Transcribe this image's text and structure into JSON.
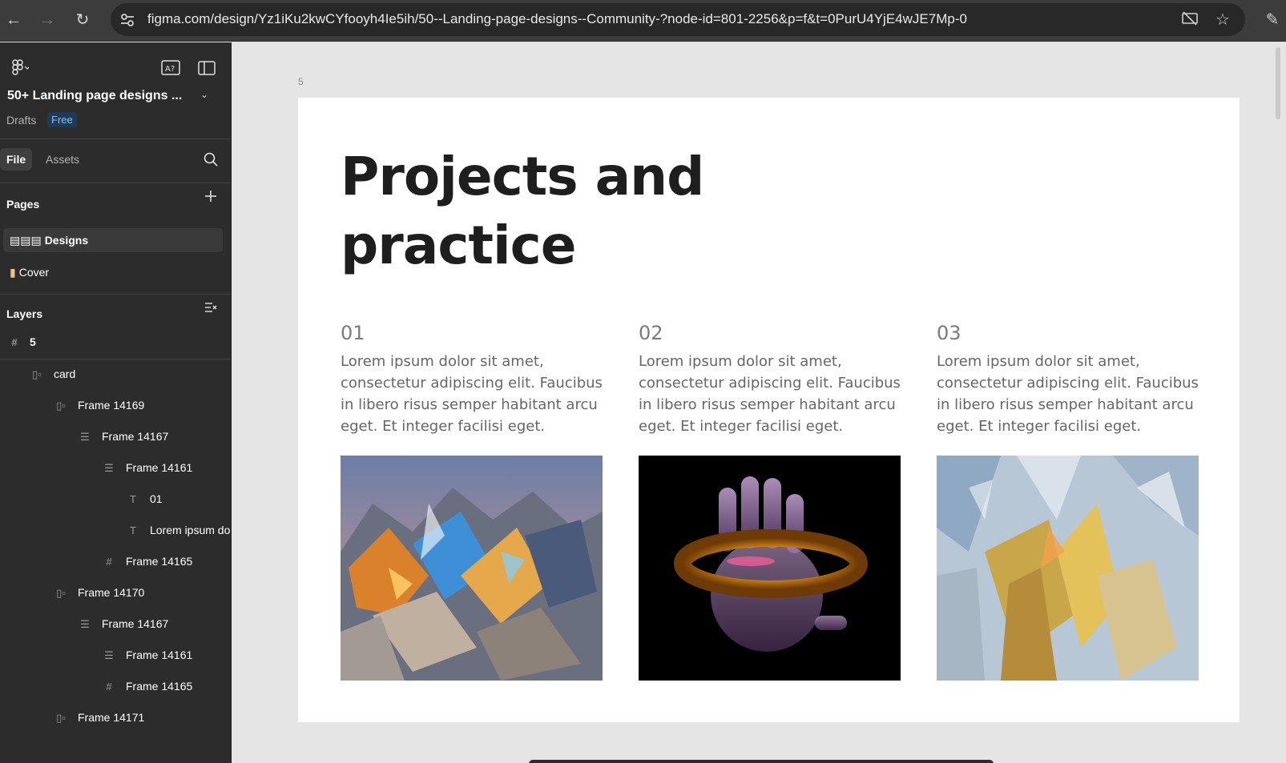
{
  "browser": {
    "url": "figma.com/design/Yz1iKu2kwCYfooyh4Ie5ih/50--Landing-page-designs--Community-?node-id=801-2256&p=f&t=0PurU4YjE4wJE7Mp-0"
  },
  "sidebar": {
    "file_title": "50+ Landing page designs ...",
    "drafts_label": "Drafts",
    "plan_badge": "Free",
    "tabs": {
      "file": "File",
      "assets": "Assets"
    },
    "pages_title": "Pages",
    "pages": [
      {
        "emoji": "▤▤▤",
        "label": "Designs"
      },
      {
        "emoji": "▮",
        "label": "Cover"
      }
    ],
    "layers_title": "Layers",
    "layers": [
      {
        "icon": "#",
        "label": "5"
      },
      {
        "icon": "▯▫",
        "label": "card"
      },
      {
        "icon": "▯▫",
        "label": "Frame 14169"
      },
      {
        "icon": "☰",
        "label": "Frame 14167"
      },
      {
        "icon": "☰",
        "label": "Frame 14161"
      },
      {
        "icon": "T",
        "label": "01"
      },
      {
        "icon": "T",
        "label": "Lorem ipsum do"
      },
      {
        "icon": "#",
        "label": "Frame 14165"
      },
      {
        "icon": "▯▫",
        "label": "Frame 14170"
      },
      {
        "icon": "☰",
        "label": "Frame 14167"
      },
      {
        "icon": "☰",
        "label": "Frame 14161"
      },
      {
        "icon": "#",
        "label": "Frame 14165"
      },
      {
        "icon": "▯▫",
        "label": "Frame 14171"
      }
    ]
  },
  "canvas": {
    "frame_label": "5",
    "heading": "Projects and practice",
    "columns": [
      {
        "number": "01",
        "text": "Lorem ipsum dolor sit amet, consectetur adipiscing elit. Faucibus in libero risus semper habitant arcu eget. Et integer facilisi eget."
      },
      {
        "number": "02",
        "text": "Lorem ipsum dolor sit amet, consectetur adipiscing elit. Faucibus in libero risus semper habitant arcu eget. Et integer facilisi eget."
      },
      {
        "number": "03",
        "text": "Lorem ipsum dolor sit amet, consectetur adipiscing elit. Faucibus in libero risus semper habitant arcu eget. Et integer facilisi eget."
      }
    ]
  },
  "colors": {
    "sidebar_bg": "#2c2c2c",
    "canvas_bg": "#e5e5e5",
    "accent_badge": "#7cc4fa"
  }
}
